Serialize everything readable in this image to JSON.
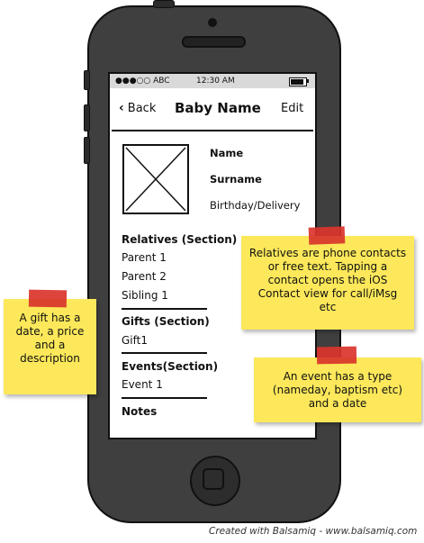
{
  "status_bar": {
    "carrier": "●●●○○ ABC",
    "time": "12:30 AM"
  },
  "navbar": {
    "back_label": "Back",
    "title": "Baby Name",
    "edit_label": "Edit"
  },
  "profile": {
    "name_label": "Name",
    "surname_label": "Surname",
    "birthday_label": "Birthday/Delivery"
  },
  "sections": {
    "relatives": {
      "header": "Relatives (Section)",
      "items": [
        "Parent 1",
        "Parent 2",
        "Sibling 1"
      ]
    },
    "gifts": {
      "header": "Gifts (Section)",
      "items": [
        "Gift1"
      ]
    },
    "events": {
      "header": "Events(Section)",
      "items": [
        "Event 1"
      ]
    },
    "notes": {
      "header": "Notes"
    }
  },
  "notes": {
    "gift": "A gift has a date, a price and a description",
    "relatives": "Relatives are phone contacts or free text. Tapping a contact opens the iOS Contact view for call/iMsg etc",
    "event": "An event has a type (nameday, baptism etc) and a date"
  },
  "footer": {
    "credit": "Created with Balsamiq - www.balsamiq.com"
  },
  "colors": {
    "phone_body": "#3f3f3f",
    "sticky_note": "#fce85a",
    "tape": "#d9342b",
    "status_bar": "#d9d9d9"
  }
}
